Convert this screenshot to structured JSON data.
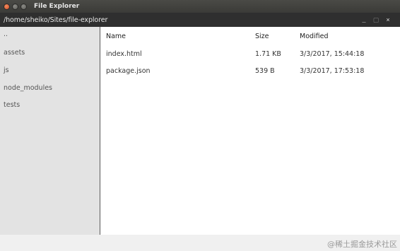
{
  "window": {
    "title": "File Explorer",
    "path": "/home/sheiko/Sites/file-explorer",
    "controls": {
      "minimize": "_",
      "maximize": "▢",
      "close": "×"
    }
  },
  "sidebar": {
    "items": [
      {
        "label": ".."
      },
      {
        "label": "assets"
      },
      {
        "label": "js"
      },
      {
        "label": "node_modules"
      },
      {
        "label": "tests"
      }
    ]
  },
  "table": {
    "headers": {
      "name": "Name",
      "size": "Size",
      "modified": "Modified"
    },
    "rows": [
      {
        "name": "index.html",
        "size": "1.71 KB",
        "modified": "3/3/2017, 15:44:18"
      },
      {
        "name": "package.json",
        "size": "539 B",
        "modified": "3/3/2017, 17:53:18"
      }
    ]
  },
  "watermark": "@稀土掘金技术社区"
}
